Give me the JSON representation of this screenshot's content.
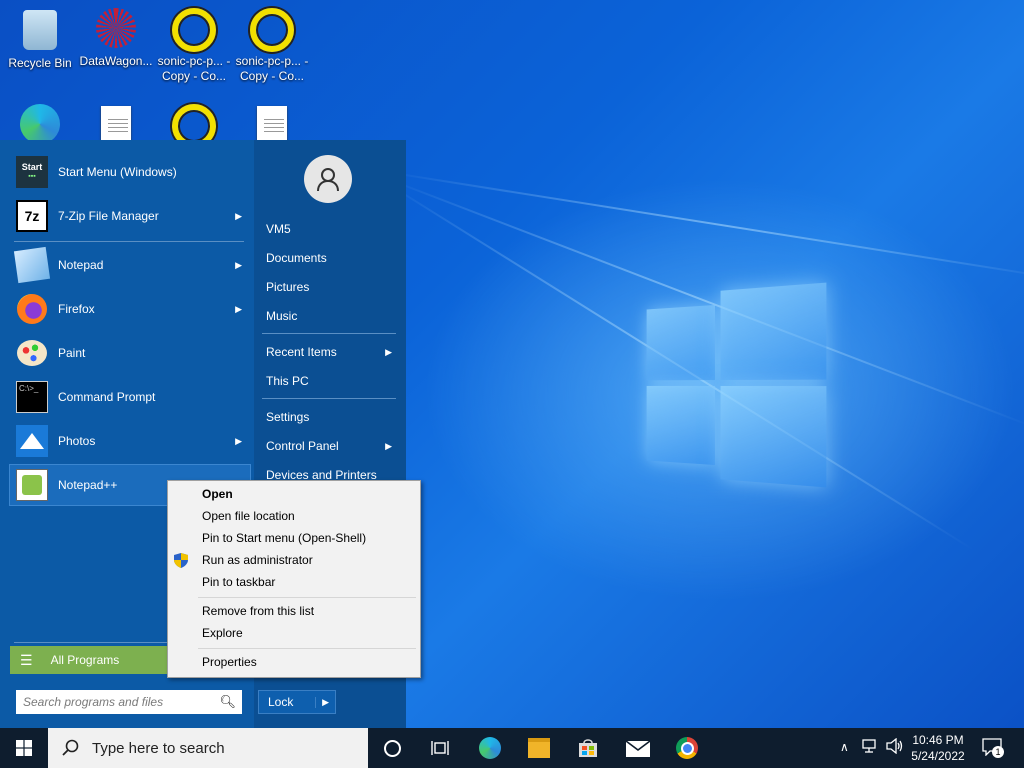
{
  "desktop": {
    "icons": [
      {
        "label": "Recycle Bin",
        "icon": "recycle-bin-icon"
      },
      {
        "label": "DataWagon...",
        "icon": "datawagon-icon"
      },
      {
        "label": "sonic-pc-p... - Copy - Co...",
        "icon": "ring-icon"
      },
      {
        "label": "sonic-pc-p... - Copy - Co...",
        "icon": "ring-icon"
      },
      {
        "label": "",
        "icon": "edge-icon"
      },
      {
        "label": "",
        "icon": "document-icon"
      },
      {
        "label": "",
        "icon": "ring-icon"
      },
      {
        "label": "",
        "icon": "document-icon"
      }
    ]
  },
  "start_menu": {
    "programs": [
      {
        "label": "Start Menu (Windows)",
        "icon": "start-menu-icon",
        "submenu": false
      },
      {
        "label": "7-Zip File Manager",
        "icon": "7zip-icon",
        "submenu": true
      },
      {
        "label": "Notepad",
        "icon": "notepad-icon",
        "submenu": true
      },
      {
        "label": "Firefox",
        "icon": "firefox-icon",
        "submenu": true
      },
      {
        "label": "Paint",
        "icon": "paint-icon",
        "submenu": false
      },
      {
        "label": "Command Prompt",
        "icon": "command-prompt-icon",
        "submenu": false
      },
      {
        "label": "Photos",
        "icon": "photos-icon",
        "submenu": true
      },
      {
        "label": "Notepad++",
        "icon": "notepadpp-icon",
        "submenu": false,
        "selected": true
      }
    ],
    "start_icon_text": "Start",
    "zip_icon_text": "7z",
    "cmd_icon_text": "C:\\>_",
    "right_items": [
      {
        "label": "VM5",
        "submenu": false
      },
      {
        "label": "Documents",
        "submenu": false
      },
      {
        "label": "Pictures",
        "submenu": false
      },
      {
        "label": "Music",
        "submenu": false
      },
      {
        "label": "Recent Items",
        "submenu": true
      },
      {
        "label": "This PC",
        "submenu": false
      },
      {
        "label": "Settings",
        "submenu": false
      },
      {
        "label": "Control Panel",
        "submenu": true
      },
      {
        "label": "Devices and Printers",
        "submenu": false
      }
    ],
    "all_programs_label": "All Programs",
    "search_placeholder": "Search programs and files",
    "lock_label": "Lock"
  },
  "context_menu": {
    "items": [
      {
        "label": "Open",
        "bold": true
      },
      {
        "label": "Open file location"
      },
      {
        "label": "Pin to Start menu (Open-Shell)"
      },
      {
        "label": "Run as administrator",
        "icon": "uac-shield-icon"
      },
      {
        "label": "Pin to taskbar"
      },
      {
        "label": "Remove from this list"
      },
      {
        "label": "Explore"
      },
      {
        "label": "Properties"
      }
    ]
  },
  "taskbar": {
    "search_placeholder": "Type here to search",
    "pinned": [
      "cortana-icon",
      "task-view-icon",
      "edge-icon",
      "file-explorer-icon",
      "store-icon",
      "mail-icon",
      "chrome-icon"
    ],
    "clock_time": "10:46 PM",
    "clock_date": "5/24/2022",
    "notification_count": "1"
  }
}
